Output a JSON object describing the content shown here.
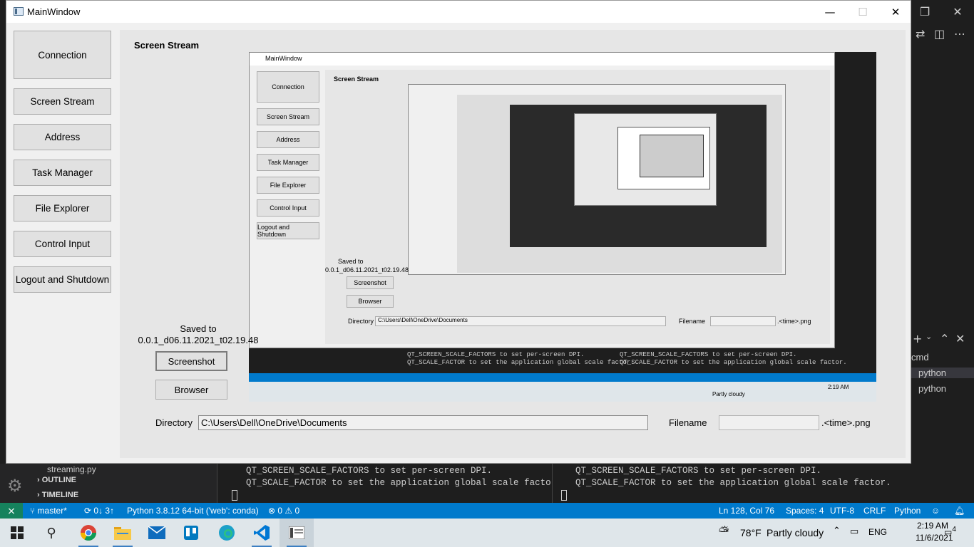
{
  "window": {
    "title": "MainWindow",
    "controls": {
      "minimize": "—",
      "maximize": "☐",
      "close": "✕"
    }
  },
  "nav": [
    {
      "label": "Connection"
    },
    {
      "label": "Screen Stream"
    },
    {
      "label": "Address"
    },
    {
      "label": "Task Manager"
    },
    {
      "label": "File Explorer"
    },
    {
      "label": "Control Input"
    },
    {
      "label": "Logout and Shutdown"
    }
  ],
  "main": {
    "heading": "Screen Stream",
    "saved_label": "Saved to",
    "saved_path": "0.0.1_d06.11.2021_t02.19.48",
    "screenshot_button": "Screenshot",
    "browser_button": "Browser",
    "directory_label": "Directory",
    "directory_value": "C:\\Users\\Dell\\OneDrive\\Documents",
    "filename_label": "Filename",
    "filename_value": "",
    "filename_suffix": ".<time>.png"
  },
  "vscode": {
    "file_name": "streaming.py",
    "outline_label": "OUTLINE",
    "timeline_label": "TIMELINE",
    "terminal_line1": "QT_SCREEN_SCALE_FACTORS to set per-screen DPI.",
    "terminal_line2": "QT_SCALE_FACTOR to set the application global scale factor.",
    "terminal_tabs": [
      "cmd",
      "python",
      "python"
    ],
    "status": {
      "branch": "master*",
      "sync": "0↓ 3↑",
      "interpreter": "Python 3.8.12 64-bit ('web': conda)",
      "problems": "⊗ 0 ⚠ 0",
      "position": "Ln 128, Col 76",
      "spaces": "Spaces: 4",
      "encoding": "UTF-8",
      "eol": "CRLF",
      "language": "Python"
    }
  },
  "taskbar": {
    "weather_temp": "78°F",
    "weather_text": "Partly cloudy",
    "language": "ENG",
    "time": "2:19 AM",
    "date": "11/6/2021",
    "notifications": "4"
  },
  "icons": {
    "start": "windows-start-icon",
    "search": "search-icon",
    "chrome": "chrome-icon",
    "explorer": "file-explorer-icon",
    "mail": "mail-icon",
    "trello": "trello-icon",
    "edge": "edge-icon",
    "vscode": "vscode-icon",
    "app": "python-app-icon"
  },
  "colors": {
    "statusbar": "#007acc",
    "taskbar": "#dfe6ea",
    "window_bg": "#f0f0f0",
    "content_bg": "#e6e6e6",
    "editor_bg": "#1e1e1e"
  }
}
